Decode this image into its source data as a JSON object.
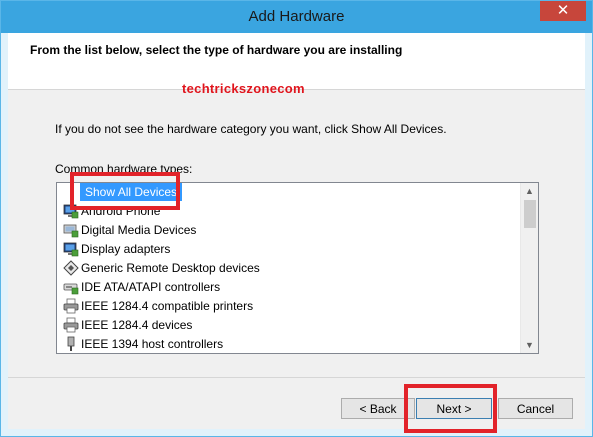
{
  "window": {
    "title": "Add Hardware",
    "close_symbol": "✕"
  },
  "header": {
    "heading": "From the list below, select the type of hardware you are installing"
  },
  "watermark": "techtrickszonecom",
  "instruction": "If you do not see the hardware category you want, click Show All Devices.",
  "list": {
    "label": "Common hardware types:",
    "items": [
      {
        "label": "Show All Devices",
        "icon": "none",
        "selected": true
      },
      {
        "label": "Android Phone",
        "icon": "monitor-icon"
      },
      {
        "label": "Digital Media Devices",
        "icon": "media-device-icon"
      },
      {
        "label": "Display adapters",
        "icon": "monitor-icon"
      },
      {
        "label": "Generic Remote Desktop devices",
        "icon": "remote-desktop-icon"
      },
      {
        "label": "IDE ATA/ATAPI controllers",
        "icon": "drive-controller-icon"
      },
      {
        "label": "IEEE 1284.4 compatible printers",
        "icon": "printer-icon"
      },
      {
        "label": "IEEE 1284.4 devices",
        "icon": "printer-icon"
      },
      {
        "label": "IEEE 1394 host controllers",
        "icon": "connector-icon"
      }
    ],
    "scroll_up": "▲",
    "scroll_down": "▼"
  },
  "buttons": {
    "back": "< Back",
    "next": "Next >",
    "cancel": "Cancel"
  },
  "colors": {
    "titlebar": "#3aa5e0",
    "selection": "#3399ff",
    "highlight_box": "#e2232a",
    "watermark": "#e0151d"
  }
}
